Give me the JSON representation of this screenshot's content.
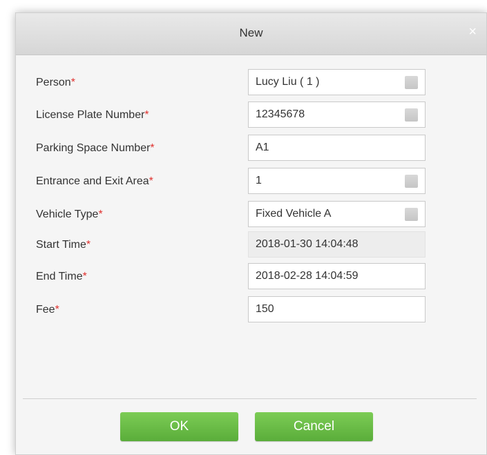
{
  "dialog": {
    "title": "New",
    "close_label": "×"
  },
  "form": {
    "required_marker": "*",
    "fields": [
      {
        "label": "Person",
        "value": "Lucy Liu ( 1 )",
        "type": "select"
      },
      {
        "label": "License Plate Number",
        "value": "12345678",
        "type": "select"
      },
      {
        "label": "Parking Space Number",
        "value": "A1",
        "type": "text"
      },
      {
        "label": "Entrance and Exit Area",
        "value": "1",
        "type": "select"
      },
      {
        "label": "Vehicle Type",
        "value": "Fixed Vehicle A",
        "type": "select"
      },
      {
        "label": "Start Time",
        "value": "2018-01-30 14:04:48",
        "type": "disabled"
      },
      {
        "label": "End Time",
        "value": "2018-02-28 14:04:59",
        "type": "text"
      },
      {
        "label": "Fee",
        "value": "150",
        "type": "text"
      }
    ]
  },
  "buttons": {
    "ok_label": "OK",
    "cancel_label": "Cancel"
  },
  "colors": {
    "button_green": "#64b843",
    "required_red": "#e0312e"
  }
}
